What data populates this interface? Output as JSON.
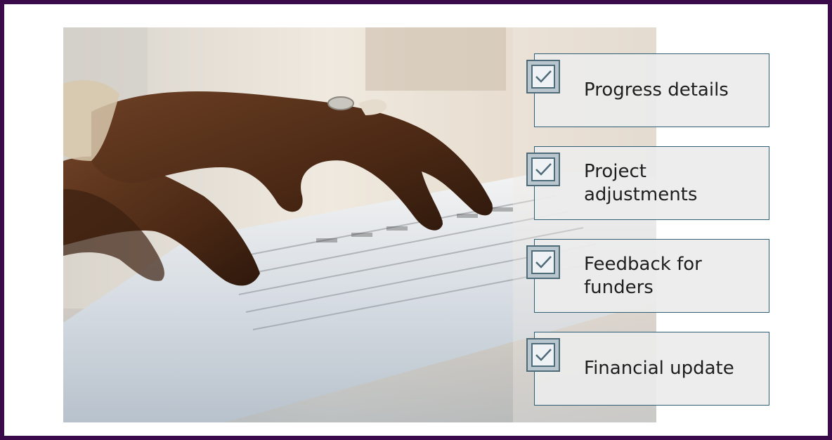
{
  "slide": {
    "checklist": [
      {
        "label": "Progress details",
        "checked": true,
        "icon": "checkbox-checked-icon"
      },
      {
        "label": "Project\nadjustments",
        "checked": true,
        "icon": "checkbox-checked-icon"
      },
      {
        "label": "Feedback for\nfunders",
        "checked": true,
        "icon": "checkbox-checked-icon"
      },
      {
        "label": "Financial update",
        "checked": true,
        "icon": "checkbox-checked-icon"
      }
    ]
  },
  "colors": {
    "frame": "#3b0a4a",
    "card_border": "#2f5f74",
    "card_fill": "#ececec",
    "checkbox_border": "#4e6b7a"
  }
}
